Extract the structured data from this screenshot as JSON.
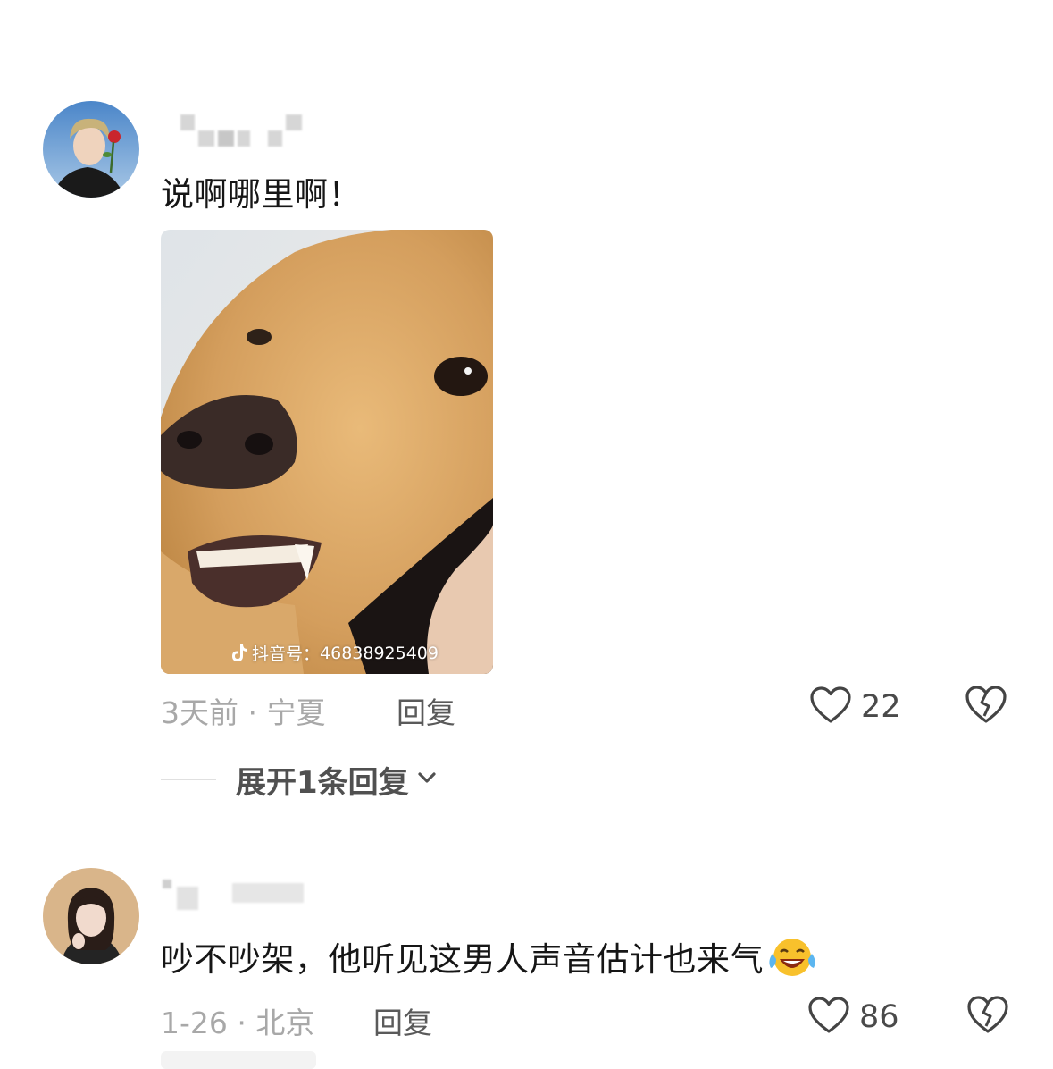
{
  "comments": [
    {
      "avatar_icon": "avatar-man-with-rose",
      "text": "说啊哪里啊！",
      "media": {
        "type": "image",
        "subject": "golden-retriever-baring-teeth",
        "watermark_prefix": "抖音号：",
        "watermark_id": "46838925409",
        "watermark_icon": "tiktok-logo-icon"
      },
      "time_location": "3天前 · 宁夏",
      "reply_label": "回复",
      "like_count": "22",
      "expand_label": "展开1条回复"
    },
    {
      "avatar_icon": "avatar-woman-photo",
      "text": "吵不吵架，他听见这男人声音估计也来气",
      "emoji": "laughing-crying-emoji",
      "time_location": "1-26 · 北京",
      "reply_label": "回复",
      "like_count": "86"
    }
  ],
  "icons": {
    "like": "heart-outline-icon",
    "dislike": "broken-heart-icon",
    "expand": "chevron-down-icon"
  },
  "colors": {
    "text_primary": "#161616",
    "text_secondary": "#a8a8a8",
    "text_action": "#5a5a5a",
    "icon": "#444444"
  }
}
